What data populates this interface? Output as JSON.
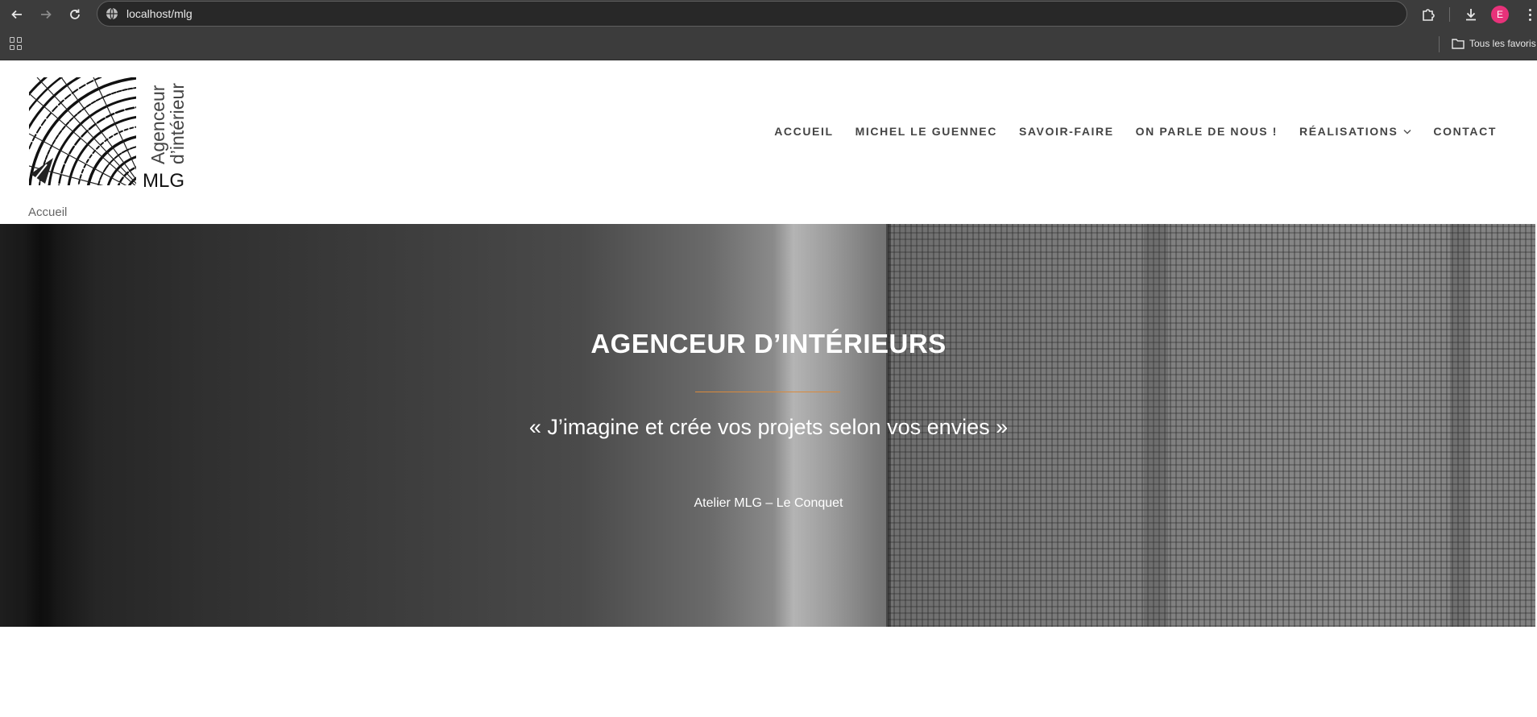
{
  "browser": {
    "url": "localhost/mlg",
    "profile_initial": "E",
    "bookmarks_folder": "Tous les favoris",
    "icons": {
      "back": "arrow-left-icon",
      "forward": "arrow-right-icon",
      "reload": "reload-icon",
      "site_info": "globe-icon",
      "extensions": "puzzle-icon",
      "downloads": "download-icon",
      "apps": "apps-grid-icon",
      "menu": "kebab-menu-icon",
      "folder": "folder-icon"
    }
  },
  "site": {
    "logo": {
      "line1": "Agenceur",
      "line2": "d’intérieur",
      "brand": "MLG"
    },
    "nav": [
      {
        "label": "ACCUEIL"
      },
      {
        "label": "MICHEL LE GUENNEC"
      },
      {
        "label": "SAVOIR-FAIRE"
      },
      {
        "label": "ON PARLE DE NOUS !"
      },
      {
        "label": "RÉALISATIONS",
        "has_dropdown": true
      },
      {
        "label": "CONTACT"
      }
    ],
    "breadcrumb": "Accueil"
  },
  "hero": {
    "title": "AGENCEUR D’INTÉRIEURS",
    "quote": "« J’imagine et crée vos projets selon vos envies »",
    "subtitle": "Atelier MLG – Le Conquet",
    "accent_color": "#d98a3c"
  }
}
